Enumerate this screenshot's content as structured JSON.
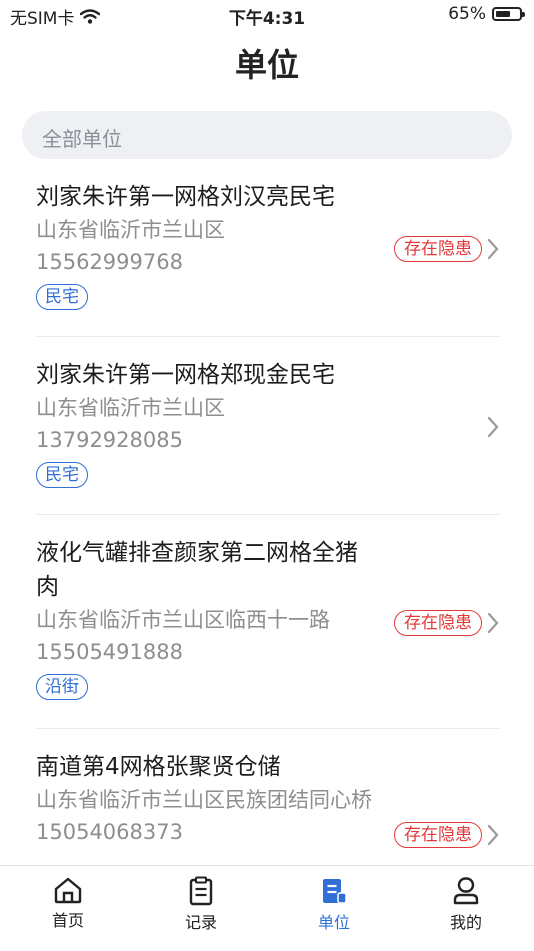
{
  "status_bar": {
    "carrier": "无SIM卡",
    "time": "下午4:31",
    "battery_text": "65%",
    "battery_level": 0.65
  },
  "header": {
    "title": "单位"
  },
  "search": {
    "placeholder": "全部单位"
  },
  "units": [
    {
      "name": "刘家朱许第一网格刘汉亮民宅",
      "address": "山东省临沂市兰山区",
      "phone": "15562999768",
      "tag": "民宅",
      "status": "存在隐患"
    },
    {
      "name": "刘家朱许第一网格郑现金民宅",
      "address": "山东省临沂市兰山区",
      "phone": "13792928085",
      "tag": "民宅",
      "status": ""
    },
    {
      "name": "液化气罐排查颜家第二网格全猪肉",
      "address": "山东省临沂市兰山区临西十一路",
      "phone": "15505491888",
      "tag": "沿街",
      "status": "存在隐患"
    },
    {
      "name": "南道第4网格张聚贤仓储",
      "address": "山东省临沂市兰山区民族团结同心桥",
      "phone": "15054068373",
      "tag": "",
      "status": "存在隐患"
    }
  ],
  "tabbar": {
    "items": [
      {
        "label": "首页",
        "icon": "home-icon"
      },
      {
        "label": "记录",
        "icon": "clipboard-icon"
      },
      {
        "label": "单位",
        "icon": "unit-icon",
        "active": true
      },
      {
        "label": "我的",
        "icon": "user-icon"
      }
    ]
  },
  "colors": {
    "accent": "#2f6fd6",
    "danger": "#e23a3a",
    "muted": "#8e8e8e"
  }
}
